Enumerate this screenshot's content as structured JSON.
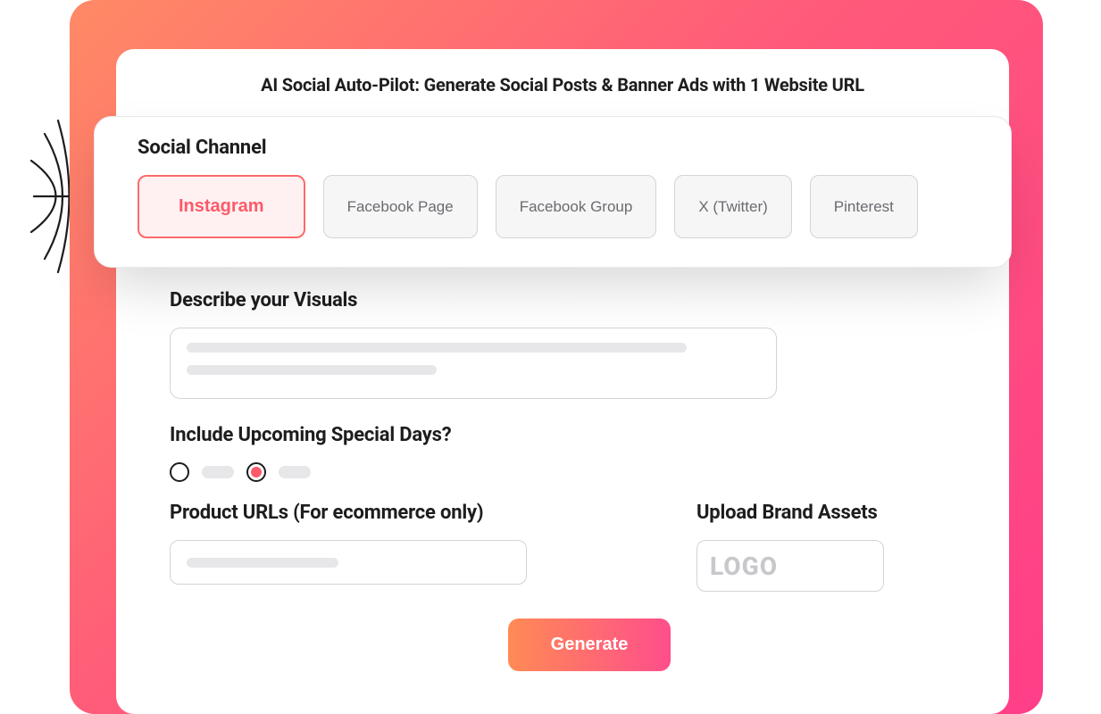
{
  "header": {
    "title": "AI Social Auto-Pilot: Generate Social Posts & Banner Ads with 1 Website URL"
  },
  "social_channel": {
    "label": "Social Channel",
    "options": [
      {
        "label": "Instagram",
        "active": true
      },
      {
        "label": "Facebook Page",
        "active": false
      },
      {
        "label": "Facebook Group",
        "active": false
      },
      {
        "label": "X (Twitter)",
        "active": false
      },
      {
        "label": "Pinterest",
        "active": false
      }
    ]
  },
  "visuals": {
    "label": "Describe your Visuals"
  },
  "special_days": {
    "label": "Include Upcoming Special Days?",
    "selected_index": 1
  },
  "product_urls": {
    "label": "Product URLs (For ecommerce only)"
  },
  "brand_assets": {
    "label": "Upload Brand Assets",
    "placeholder": "LOGO"
  },
  "actions": {
    "generate": "Generate"
  }
}
